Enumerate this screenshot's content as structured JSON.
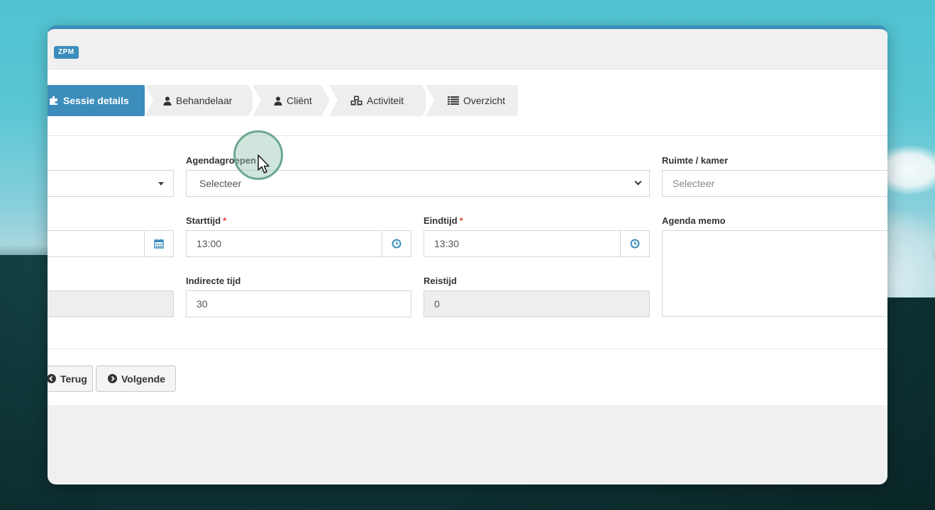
{
  "app": {
    "badge": "ZPM"
  },
  "steps": [
    {
      "label": "Sessie details",
      "icon": "puzzle-icon",
      "active": true
    },
    {
      "label": "Behandelaar",
      "icon": "user-icon",
      "active": false
    },
    {
      "label": "Cliënt",
      "icon": "user-icon",
      "active": false
    },
    {
      "label": "Activiteit",
      "icon": "cubes-icon",
      "active": false
    },
    {
      "label": "Overzicht",
      "icon": "list-icon",
      "active": false
    }
  ],
  "form": {
    "agendagroepen": {
      "label": "Agendagroepen",
      "value": "Selecteer"
    },
    "ruimte": {
      "label": "Ruimte / kamer",
      "placeholder": "Selecteer"
    },
    "starttijd": {
      "label": "Starttijd",
      "required": "*",
      "value": "13:00"
    },
    "eindtijd": {
      "label": "Eindtijd",
      "required": "*",
      "value": "13:30"
    },
    "memo": {
      "label": "Agenda memo",
      "value": ""
    },
    "indirecte_tijd": {
      "label": "Indirecte tijd",
      "value": "30"
    },
    "reistijd": {
      "label": "Reistijd",
      "value": "0"
    }
  },
  "buttons": {
    "back": "Terug",
    "next": "Volgende"
  },
  "colors": {
    "accent": "#3c8dbc",
    "required": "#dd4b39"
  }
}
